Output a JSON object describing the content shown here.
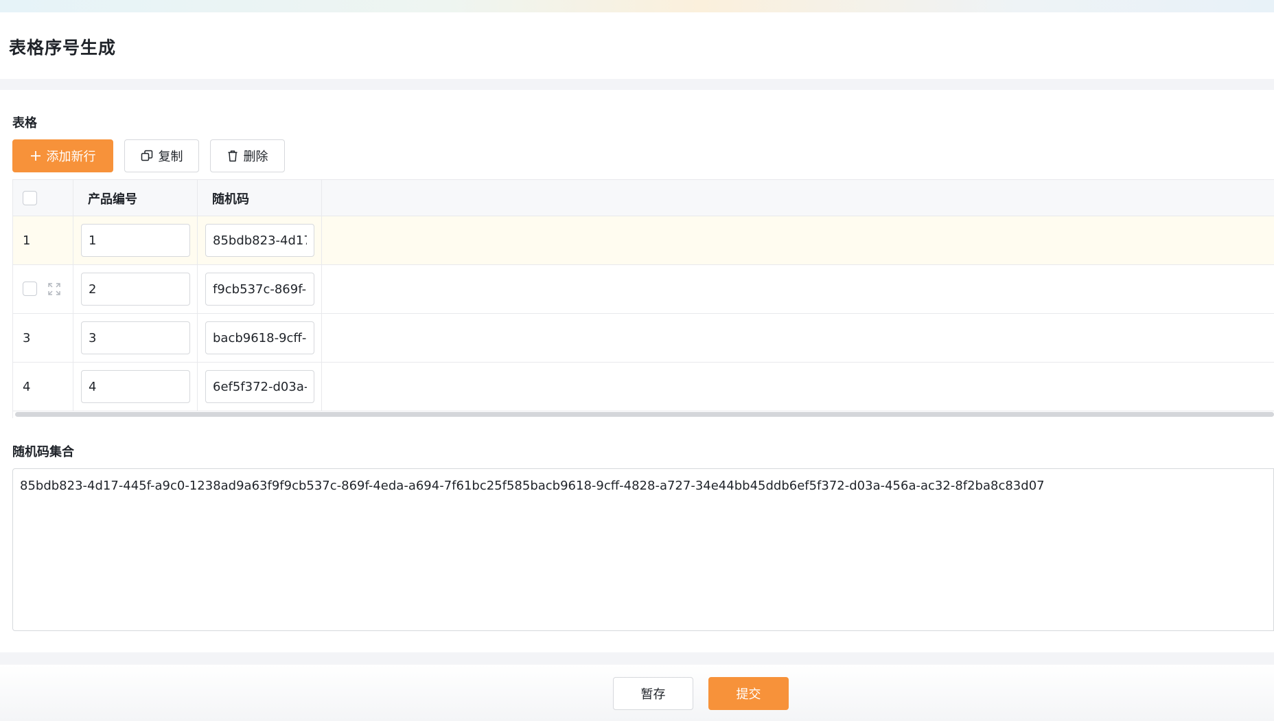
{
  "page": {
    "title": "表格序号生成"
  },
  "table_section": {
    "label": "表格",
    "toolbar": {
      "add_row": "添加新行",
      "copy": "复制",
      "delete": "删除"
    },
    "columns": [
      "产品编号",
      "随机码"
    ],
    "rows": [
      {
        "index": "1",
        "product_no": "1",
        "random_code": "85bdb823-4d17-445f-a9c0-1238ad9a63f9",
        "highlighted": true
      },
      {
        "index": "",
        "product_no": "2",
        "random_code": "f9cb537c-869f-4eda-a694-7f61bc25f585",
        "hovered": true
      },
      {
        "index": "3",
        "product_no": "3",
        "random_code": "bacb9618-9cff-4828-a727-34e44bb45ddb"
      },
      {
        "index": "4",
        "product_no": "4",
        "random_code": "6ef5f372-d03a-456a-ac32-8f2ba8c83d07"
      }
    ]
  },
  "collection_section": {
    "label": "随机码集合",
    "value": "85bdb823-4d17-445f-a9c0-1238ad9a63f9f9cb537c-869f-4eda-a694-7f61bc25f585bacb9618-9cff-4828-a727-34e44bb45ddb6ef5f372-d03a-456a-ac32-8f2ba8c83d07"
  },
  "footer": {
    "save_draft": "暂存",
    "submit": "提交"
  },
  "colors": {
    "accent": "#f7923a",
    "row_highlight": "#fffcf0",
    "border": "#d6d8dc"
  }
}
